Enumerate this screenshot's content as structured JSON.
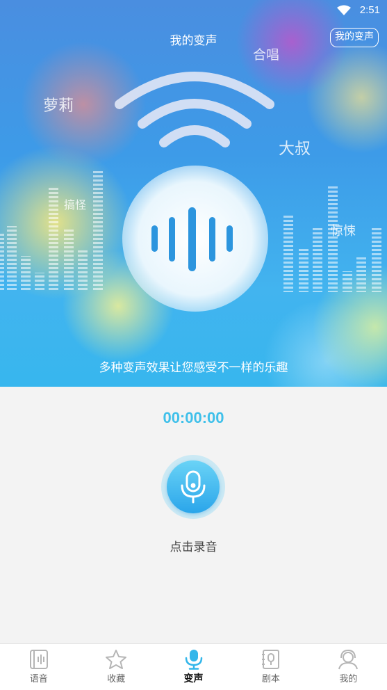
{
  "status": {
    "time": "2:51"
  },
  "header": {
    "title": "我的变声",
    "right_button": "我的变声"
  },
  "hero": {
    "labels": [
      "合唱",
      "萝莉",
      "大叔",
      "搞怪",
      "惊悚"
    ],
    "caption": "多种变声效果让您感受不一样的乐趣"
  },
  "recorder": {
    "timer": "00:00:00",
    "action_label": "点击录音"
  },
  "tabs": [
    {
      "label": "语音",
      "icon": "voice-book-icon",
      "active": false
    },
    {
      "label": "收藏",
      "icon": "star-icon",
      "active": false
    },
    {
      "label": "变声",
      "icon": "microphone-icon",
      "active": true
    },
    {
      "label": "剧本",
      "icon": "script-book-icon",
      "active": false
    },
    {
      "label": "我的",
      "icon": "user-headset-icon",
      "active": false
    }
  ],
  "colors": {
    "accent": "#3fc0ea",
    "tab_active": "#33b6ea",
    "tab_inactive": "#b5b5b5"
  }
}
